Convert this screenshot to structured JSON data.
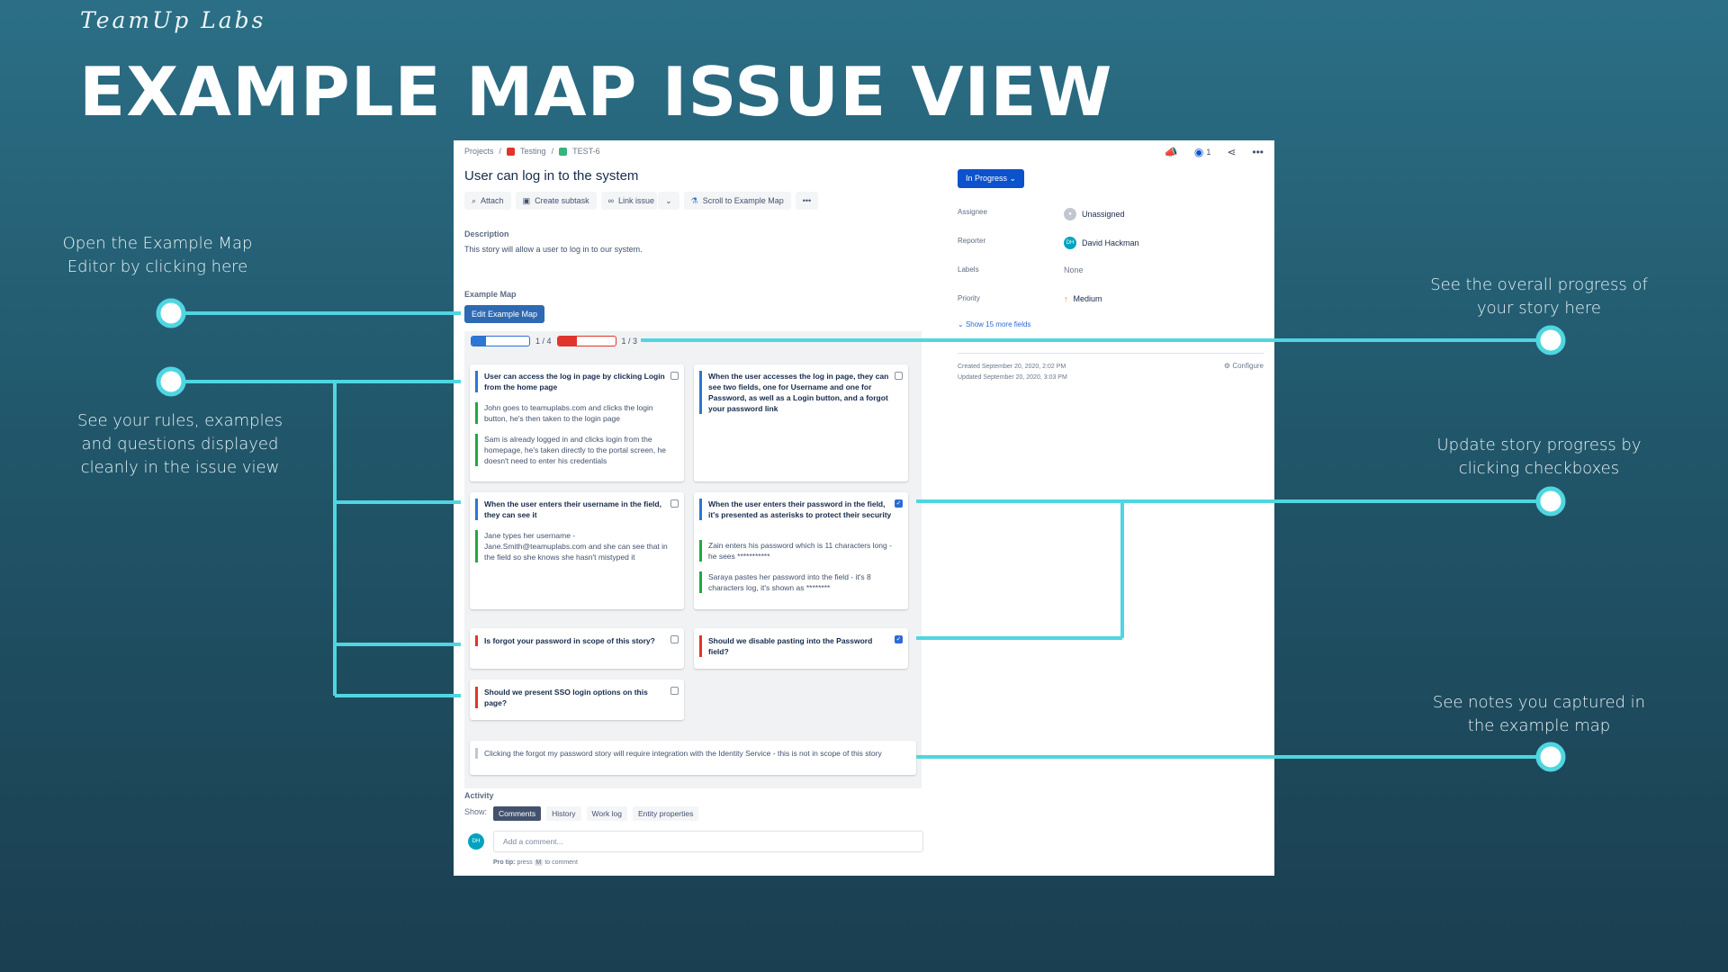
{
  "brand": "TeamUp Labs",
  "headline": "EXAMPLE MAP ISSUE VIEW",
  "callouts": {
    "open_editor": [
      "Open the Example Map",
      "Editor by clicking here"
    ],
    "rules": [
      "See your rules, examples",
      "and questions displayed",
      "cleanly in the issue view"
    ],
    "progress": [
      "See the overall progress of",
      "your story here"
    ],
    "checkboxes": [
      "Update story progress by",
      "clicking checkboxes"
    ],
    "notes": [
      "See notes you captured in",
      "the example map"
    ]
  },
  "colors": {
    "accent": "#4fd6e0",
    "rule": "#2d76d2",
    "example": "#22a845",
    "question": "#e0352b",
    "status": "#0b52cc"
  },
  "issue": {
    "breadcrumb": [
      "Projects",
      "/",
      "Testing",
      "/",
      "TEST-6"
    ],
    "top_icons": [
      "megaphone-icon",
      "eye-icon",
      "share-icon",
      "more-icon"
    ],
    "watch_count": "1",
    "title": "User can log in to the system",
    "toolbar": {
      "attach": "Attach",
      "subtask": "Create subtask",
      "link": "Link issue",
      "dropdown": "⌄",
      "scroll": "Scroll to Example Map",
      "more": "•••"
    },
    "description_label": "Description",
    "description": "This story will allow a user to log in to our system.",
    "example_map_label": "Example Map",
    "edit_button": "Edit Example Map",
    "progress": {
      "rules_text": "1 / 4",
      "rules_fraction": 0.25,
      "questions_text": "1 / 3",
      "questions_fraction": 0.33
    },
    "cards": {
      "c1": {
        "rule": "User can access the log in page by clicking Login from the home page",
        "ex1": "John goes to teamuplabs.com and clicks the login button, he's then taken to the login page",
        "ex2": "Sam is already logged in and clicks login from the homepage, he's taken directly to the portal screen, he doesn't need to enter his credentials",
        "checked": false
      },
      "c2": {
        "rule": "When the user accesses the log in page, they can see two fields, one for Username and one for Password, as well as a Login button, and a forgot your password link",
        "checked": false
      },
      "c3": {
        "rule": "When the user enters their username in the field, they can see it",
        "ex1": "Jane types her username - Jane.Smith@teamuplabs.com and she can see that in the field so she knows she hasn't mistyped it",
        "checked": false
      },
      "c4": {
        "rule": "When the user enters their password in the field, it's presented as asterisks to protect their security",
        "ex1": "Zain enters his password which is 11 characters long - he sees ***********",
        "ex2": "Saraya pastes her password into the field - it's 8 characters log, it's shown as ********",
        "checked": true
      },
      "q1": {
        "text": "Is forgot your password in scope of this story?",
        "checked": false
      },
      "q2": {
        "text": "Should we disable pasting into the Password field?",
        "checked": true
      },
      "q3": {
        "text": "Should we present SSO login options on this page?",
        "checked": false
      },
      "note": "Clicking the forgot my password story will require integration with the Identity Service - this is not in scope of this story"
    },
    "sidebar": {
      "status": "In Progress",
      "assignee_label": "Assignee",
      "assignee": "Unassigned",
      "reporter_label": "Reporter",
      "reporter": "David Hackman",
      "reporter_initials": "DH",
      "labels_label": "Labels",
      "labels": "None",
      "priority_label": "Priority",
      "priority": "Medium",
      "more_fields": "Show 15 more fields",
      "created": "Created September 20, 2020, 2:02 PM",
      "updated": "Updated September 20, 2020, 3:03 PM",
      "configure": "Configure"
    },
    "activity": {
      "label": "Activity",
      "show": "Show:",
      "tabs": [
        "Comments",
        "History",
        "Work log",
        "Entity properties"
      ],
      "placeholder": "Add a comment...",
      "initials": "DH",
      "protip_a": "Pro tip:",
      "protip_b": "press",
      "protip_key": "M",
      "protip_c": "to comment"
    }
  }
}
